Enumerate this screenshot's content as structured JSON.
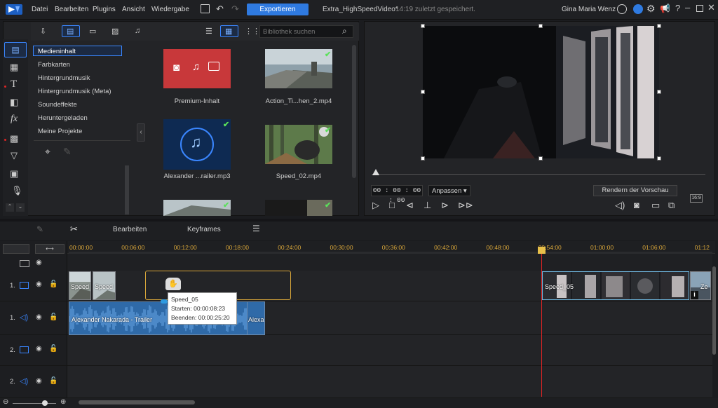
{
  "menu": {
    "file": "Datei",
    "edit": "Bearbeiten",
    "plugins": "Plugins",
    "view": "Ansicht",
    "playback": "Wiedergabe",
    "export_label": "Exportieren"
  },
  "project": {
    "title": "Extra_HighSpeedVideo*",
    "saved": "14:19 zuletzt gespeichert."
  },
  "user": {
    "name": "Gina Maria Wenz"
  },
  "library": {
    "search_placeholder": "Bibliothek suchen",
    "categories": [
      "Medieninhalt",
      "Farbkarten",
      "Hintergrundmusik",
      "Hintergrundmusik (Meta)",
      "Soundeffekte",
      "Heruntergeladen",
      "Meine Projekte"
    ],
    "items": [
      {
        "label": "Premium-Inhalt"
      },
      {
        "label": "Action_Ti...hen_2.mp4"
      },
      {
        "label": "Alexander ...railer.mp3"
      },
      {
        "label": "Speed_02.mp4"
      },
      {
        "label": ""
      },
      {
        "label": ""
      }
    ]
  },
  "preview": {
    "timecode": "00 : 00 : 00 : 00",
    "fit_label": "Anpassen ▾",
    "render_label": "Rendern der Vorschau",
    "aspect_label": "16:9"
  },
  "timeline": {
    "edit_label": "Bearbeiten",
    "keyframes_label": "Keyframes",
    "ticks": [
      "00:00:00",
      "00:06:00",
      "00:12:00",
      "00:18:00",
      "00:24:00",
      "00:30:00",
      "00:36:00",
      "00:42:00",
      "00:48:00",
      "00:54:00",
      "01:00:00",
      "01:06:00",
      "01:12"
    ],
    "tracks": [
      {
        "num": "1."
      },
      {
        "num": "1."
      },
      {
        "num": "2."
      },
      {
        "num": "2."
      }
    ],
    "clips": {
      "v1a": "Speed",
      "v1b": "Speed",
      "v1c": "Speed_05",
      "v1d": "Ze",
      "a1a": "Alexander Nakarada - Trailer",
      "a1b": "Alexa"
    },
    "tooltip": {
      "name": "Speed_05",
      "start": "Starten: 00:00:08:23",
      "end": "Beenden: 00:00:25:20"
    }
  },
  "colors": {
    "accent": "#2f7ae0",
    "ruler_text": "#d8a63a",
    "playhead": "#e02424",
    "check": "#5be15b"
  }
}
